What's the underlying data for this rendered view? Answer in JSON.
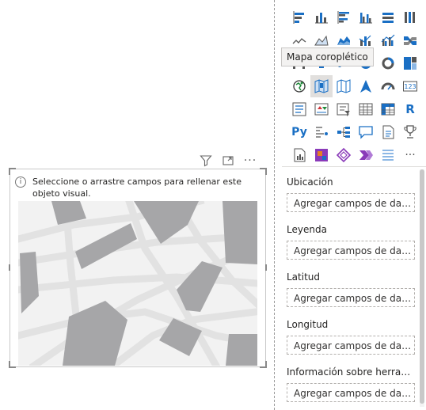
{
  "visual": {
    "info_text": "Seleccione o arrastre campos para rellenar este objeto visual.",
    "header_icons": [
      "filter-icon",
      "focus-mode-icon",
      "more-options-icon"
    ],
    "more_glyph": "···"
  },
  "panel": {
    "tooltip": "Mapa coroplético",
    "more_glyph": "···",
    "py_label": "Py",
    "r_label": "R",
    "kpi_label": "123",
    "icons": [
      "stacked-bar-chart-icon",
      "stacked-column-chart-icon",
      "clustered-bar-chart-icon",
      "clustered-column-chart-icon",
      "100-stacked-bar-chart-icon",
      "100-stacked-column-chart-icon",
      "line-chart-icon",
      "area-chart-icon",
      "stacked-area-chart-icon",
      "line-and-stacked-column-chart-icon",
      "line-and-clustered-column-chart-icon",
      "ribbon-chart-icon",
      "waterfall-chart-icon",
      "funnel-chart-icon",
      "scatter-chart-icon",
      "pie-chart-icon",
      "donut-chart-icon",
      "treemap-icon",
      "map-icon",
      "filled-map-icon",
      "shape-map-icon",
      "azure-map-icon",
      "gauge-icon",
      "card-icon",
      "multi-row-card-icon",
      "kpi-icon",
      "slicer-icon",
      "table-icon",
      "matrix-icon",
      "r-script-visual-icon",
      "python-visual-icon",
      "key-influencers-icon",
      "decomposition-tree-icon",
      "qa-icon",
      "smart-narrative-icon",
      "metrics-icon",
      "paginated-report-icon",
      "power-apps-icon",
      "power-automate-icon",
      "arcgis-icon",
      "more-visuals-icon",
      "more-options-icon"
    ]
  },
  "wells": [
    {
      "label": "Ubicación",
      "placeholder": "Agregar campos de datos a..."
    },
    {
      "label": "Leyenda",
      "placeholder": "Agregar campos de datos a..."
    },
    {
      "label": "Latitud",
      "placeholder": "Agregar campos de datos a..."
    },
    {
      "label": "Longitud",
      "placeholder": "Agregar campos de datos a..."
    },
    {
      "label": "Información sobre herramientas",
      "placeholder": "Agregar campos de datos a..."
    }
  ],
  "colors": {
    "accent_blue": "#1a6fc4",
    "map_shape_gray": "#a6a6a8",
    "map_road": "#e2e2e2",
    "map_bg": "#f2f2f2",
    "green": "#1e8a3a",
    "red": "#d13438",
    "orange": "#e67e22",
    "purple": "#8a3ab9"
  }
}
